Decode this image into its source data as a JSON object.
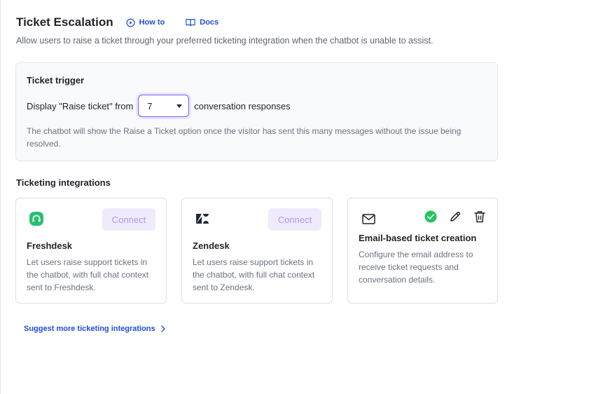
{
  "header": {
    "title": "Ticket Escalation",
    "how_to_label": "How to",
    "docs_label": "Docs",
    "subtitle": "Allow users to raise a ticket through your preferred ticketing integration when the chatbot is unable to assist."
  },
  "trigger": {
    "title": "Ticket trigger",
    "prefix": "Display \"Raise ticket\" from",
    "selected_value": "7",
    "suffix": "conversation responses",
    "help": "The chatbot will show the Raise a Ticket option once the visitor has sent this many messages without the issue being resolved."
  },
  "integrations": {
    "title": "Ticketing integrations",
    "cards": [
      {
        "name": "Freshdesk",
        "description": "Let users raise support tickets in the chatbot, with full chat context sent to Freshdesk.",
        "connect_label": "Connect",
        "icon": "freshdesk-logo-icon"
      },
      {
        "name": "Zendesk",
        "description": "Let users raise support tickets in the chatbot, with full chat context sent to Zendesk.",
        "connect_label": "Connect",
        "icon": "zendesk-logo-icon"
      },
      {
        "name": "Email-based ticket creation",
        "description": "Configure the email address to receive ticket requests and conversation details.",
        "icon": "envelope-icon",
        "status": "connected"
      }
    ]
  },
  "suggest_label": "Suggest more ticketing integrations",
  "colors": {
    "accent": "#1d4ed8",
    "focus": "#7c5cff",
    "connect_bg": "#efeafc",
    "connect_text": "#a99cef",
    "success": "#22c55e",
    "freshdesk": "#25c16f"
  }
}
